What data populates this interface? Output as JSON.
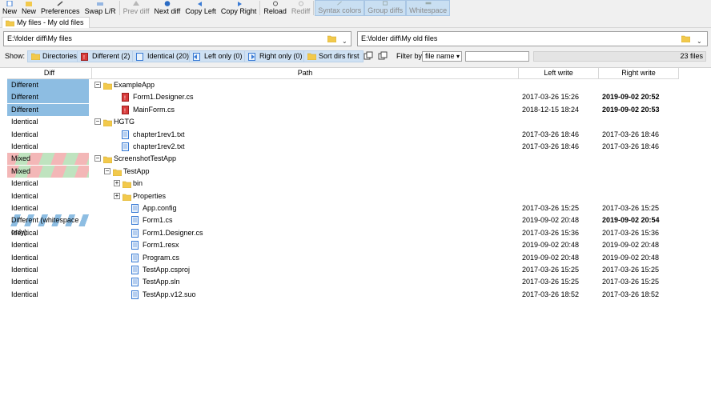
{
  "toolbar": {
    "buttons": [
      {
        "label": "New",
        "icon": "new-file-icon",
        "disabled": false
      },
      {
        "label": "New",
        "icon": "new-folder-icon",
        "disabled": false
      },
      {
        "label": "Preferences",
        "icon": "wrench-icon",
        "disabled": false
      },
      {
        "label": "Swap L/R",
        "icon": "swap-icon",
        "disabled": false
      },
      {
        "label": "Prev diff",
        "icon": "arrow-up-icon",
        "disabled": true
      },
      {
        "label": "Next diff",
        "icon": "arrow-down-icon",
        "disabled": false
      },
      {
        "label": "Copy Left",
        "icon": "copy-left-icon",
        "disabled": false
      },
      {
        "label": "Copy Right",
        "icon": "copy-right-icon",
        "disabled": false
      },
      {
        "label": "Reload",
        "icon": "reload-icon",
        "disabled": false
      },
      {
        "label": "Rediff",
        "icon": "rediff-icon",
        "disabled": true
      },
      {
        "label": "Syntax colors",
        "icon": "syntax-icon",
        "toggle": true
      },
      {
        "label": "Group diffs",
        "icon": "group-icon",
        "toggle": true
      },
      {
        "label": "Whitespace",
        "icon": "whitespace-icon",
        "toggle": true
      }
    ]
  },
  "tab": {
    "label": "My files  -  My old files"
  },
  "left_path": "E:\\folder diff\\My files",
  "right_path": "E:\\folder diff\\My old files",
  "show": {
    "label": "Show:",
    "chips": [
      {
        "label": "Directories",
        "icon": "folder-icon"
      },
      {
        "label": "Different (2)",
        "icon": "different-file-icon"
      },
      {
        "label": "Identical (20)",
        "icon": "identical-file-icon"
      },
      {
        "label": "Left only (0)",
        "icon": "left-only-icon"
      },
      {
        "label": "Right only (0)",
        "icon": "right-only-icon"
      },
      {
        "label": "Sort dirs first",
        "icon": "sort-folder-icon"
      }
    ],
    "filter_label": "Filter by",
    "filter_select": "file name",
    "filter_value": "",
    "count": "23 files"
  },
  "columns": {
    "diff": "Diff",
    "path": "Path",
    "left": "Left write",
    "right": "Right write"
  },
  "rows": [
    {
      "diff": "Different",
      "kind": "different",
      "depth": 0,
      "type": "folder",
      "expander": "−",
      "name": "ExampleApp",
      "left": "",
      "right": "",
      "bold": false
    },
    {
      "diff": "Different",
      "kind": "different",
      "depth": 1,
      "type": "diff",
      "expander": "",
      "name": "Form1.Designer.cs",
      "left": "2017-03-26 15:26",
      "right": "2019-09-02 20:52",
      "bold": true
    },
    {
      "diff": "Different",
      "kind": "different",
      "depth": 1,
      "type": "diff",
      "expander": "",
      "name": "MainForm.cs",
      "left": "2018-12-15 18:24",
      "right": "2019-09-02 20:53",
      "bold": true
    },
    {
      "diff": "Identical",
      "kind": "identical",
      "depth": 0,
      "type": "folder",
      "expander": "−",
      "name": "HGTG",
      "left": "",
      "right": "",
      "bold": false
    },
    {
      "diff": "Identical",
      "kind": "identical",
      "depth": 1,
      "type": "file",
      "expander": "",
      "name": "chapter1rev1.txt",
      "left": "2017-03-26 18:46",
      "right": "2017-03-26 18:46",
      "bold": false
    },
    {
      "diff": "Identical",
      "kind": "identical",
      "depth": 1,
      "type": "file",
      "expander": "",
      "name": "chapter1rev2.txt",
      "left": "2017-03-26 18:46",
      "right": "2017-03-26 18:46",
      "bold": false
    },
    {
      "diff": "Mixed",
      "kind": "mixed",
      "depth": 0,
      "type": "folder",
      "expander": "−",
      "name": "ScreenshotTestApp",
      "left": "",
      "right": "",
      "bold": false
    },
    {
      "diff": "Mixed",
      "kind": "mixed",
      "depth": 1,
      "type": "folder",
      "expander": "−",
      "name": "TestApp",
      "left": "",
      "right": "",
      "bold": false
    },
    {
      "diff": "Identical",
      "kind": "identical",
      "depth": 2,
      "type": "folder",
      "expander": "+",
      "name": "bin",
      "left": "",
      "right": "",
      "bold": false
    },
    {
      "diff": "Identical",
      "kind": "identical",
      "depth": 2,
      "type": "folder",
      "expander": "+",
      "name": "Properties",
      "left": "",
      "right": "",
      "bold": false
    },
    {
      "diff": "Identical",
      "kind": "identical",
      "depth": 2,
      "type": "file",
      "expander": "",
      "name": "App.config",
      "left": "2017-03-26 15:25",
      "right": "2017-03-26 15:25",
      "bold": false
    },
    {
      "diff": "Different (whitespace only)",
      "kind": "ws",
      "depth": 2,
      "type": "file",
      "expander": "",
      "name": "Form1.cs",
      "left": "2019-09-02 20:48",
      "right": "2019-09-02 20:54",
      "bold": true
    },
    {
      "diff": "Identical",
      "kind": "identical",
      "depth": 2,
      "type": "file",
      "expander": "",
      "name": "Form1.Designer.cs",
      "left": "2017-03-26 15:36",
      "right": "2017-03-26 15:36",
      "bold": false
    },
    {
      "diff": "Identical",
      "kind": "identical",
      "depth": 2,
      "type": "file",
      "expander": "",
      "name": "Form1.resx",
      "left": "2019-09-02 20:48",
      "right": "2019-09-02 20:48",
      "bold": false
    },
    {
      "diff": "Identical",
      "kind": "identical",
      "depth": 2,
      "type": "file",
      "expander": "",
      "name": "Program.cs",
      "left": "2019-09-02 20:48",
      "right": "2019-09-02 20:48",
      "bold": false
    },
    {
      "diff": "Identical",
      "kind": "identical",
      "depth": 2,
      "type": "file",
      "expander": "",
      "name": "TestApp.csproj",
      "left": "2017-03-26 15:25",
      "right": "2017-03-26 15:25",
      "bold": false
    },
    {
      "diff": "Identical",
      "kind": "identical",
      "depth": 2,
      "type": "file",
      "expander": "",
      "name": "TestApp.sln",
      "left": "2017-03-26 15:25",
      "right": "2017-03-26 15:25",
      "bold": false
    },
    {
      "diff": "Identical",
      "kind": "identical",
      "depth": 2,
      "type": "file",
      "expander": "",
      "name": "TestApp.v12.suo",
      "left": "2017-03-26 18:52",
      "right": "2017-03-26 18:52",
      "bold": false
    }
  ],
  "colors": {
    "different": "#8dbde2",
    "mixed_red": "#f3b7b7",
    "mixed_green": "#bfe3bf",
    "folder": "#f2c94c",
    "diff_file": "#d83b3b"
  }
}
